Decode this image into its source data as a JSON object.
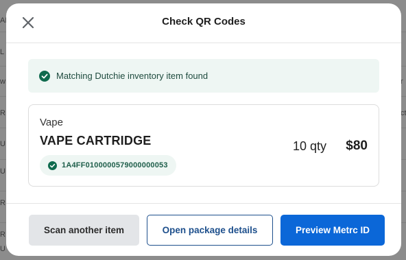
{
  "background": {
    "fragments": [
      "AR",
      "L",
      "w",
      "R",
      "U",
      "U",
      "R",
      "R",
      "U",
      "r",
      "ct"
    ]
  },
  "modal": {
    "title": "Check QR Codes",
    "close_icon": "close-icon"
  },
  "alert": {
    "icon": "check-circle-icon",
    "text": "Matching Dutchie inventory item found",
    "color": "#0f6b4e"
  },
  "item": {
    "category": "Vape",
    "name": "VAPE CARTRIDGE",
    "package_id": "1A4FF0100000579000000053",
    "quantity": "10 qty",
    "price": "$80"
  },
  "actions": {
    "scan_label": "Scan another item",
    "open_label": "Open package details",
    "preview_label": "Preview Metrc ID"
  },
  "colors": {
    "primary": "#0b67d8",
    "secondary_border": "#1d4f8c",
    "success": "#0f6b4e",
    "success_bg": "#eef6f3"
  }
}
